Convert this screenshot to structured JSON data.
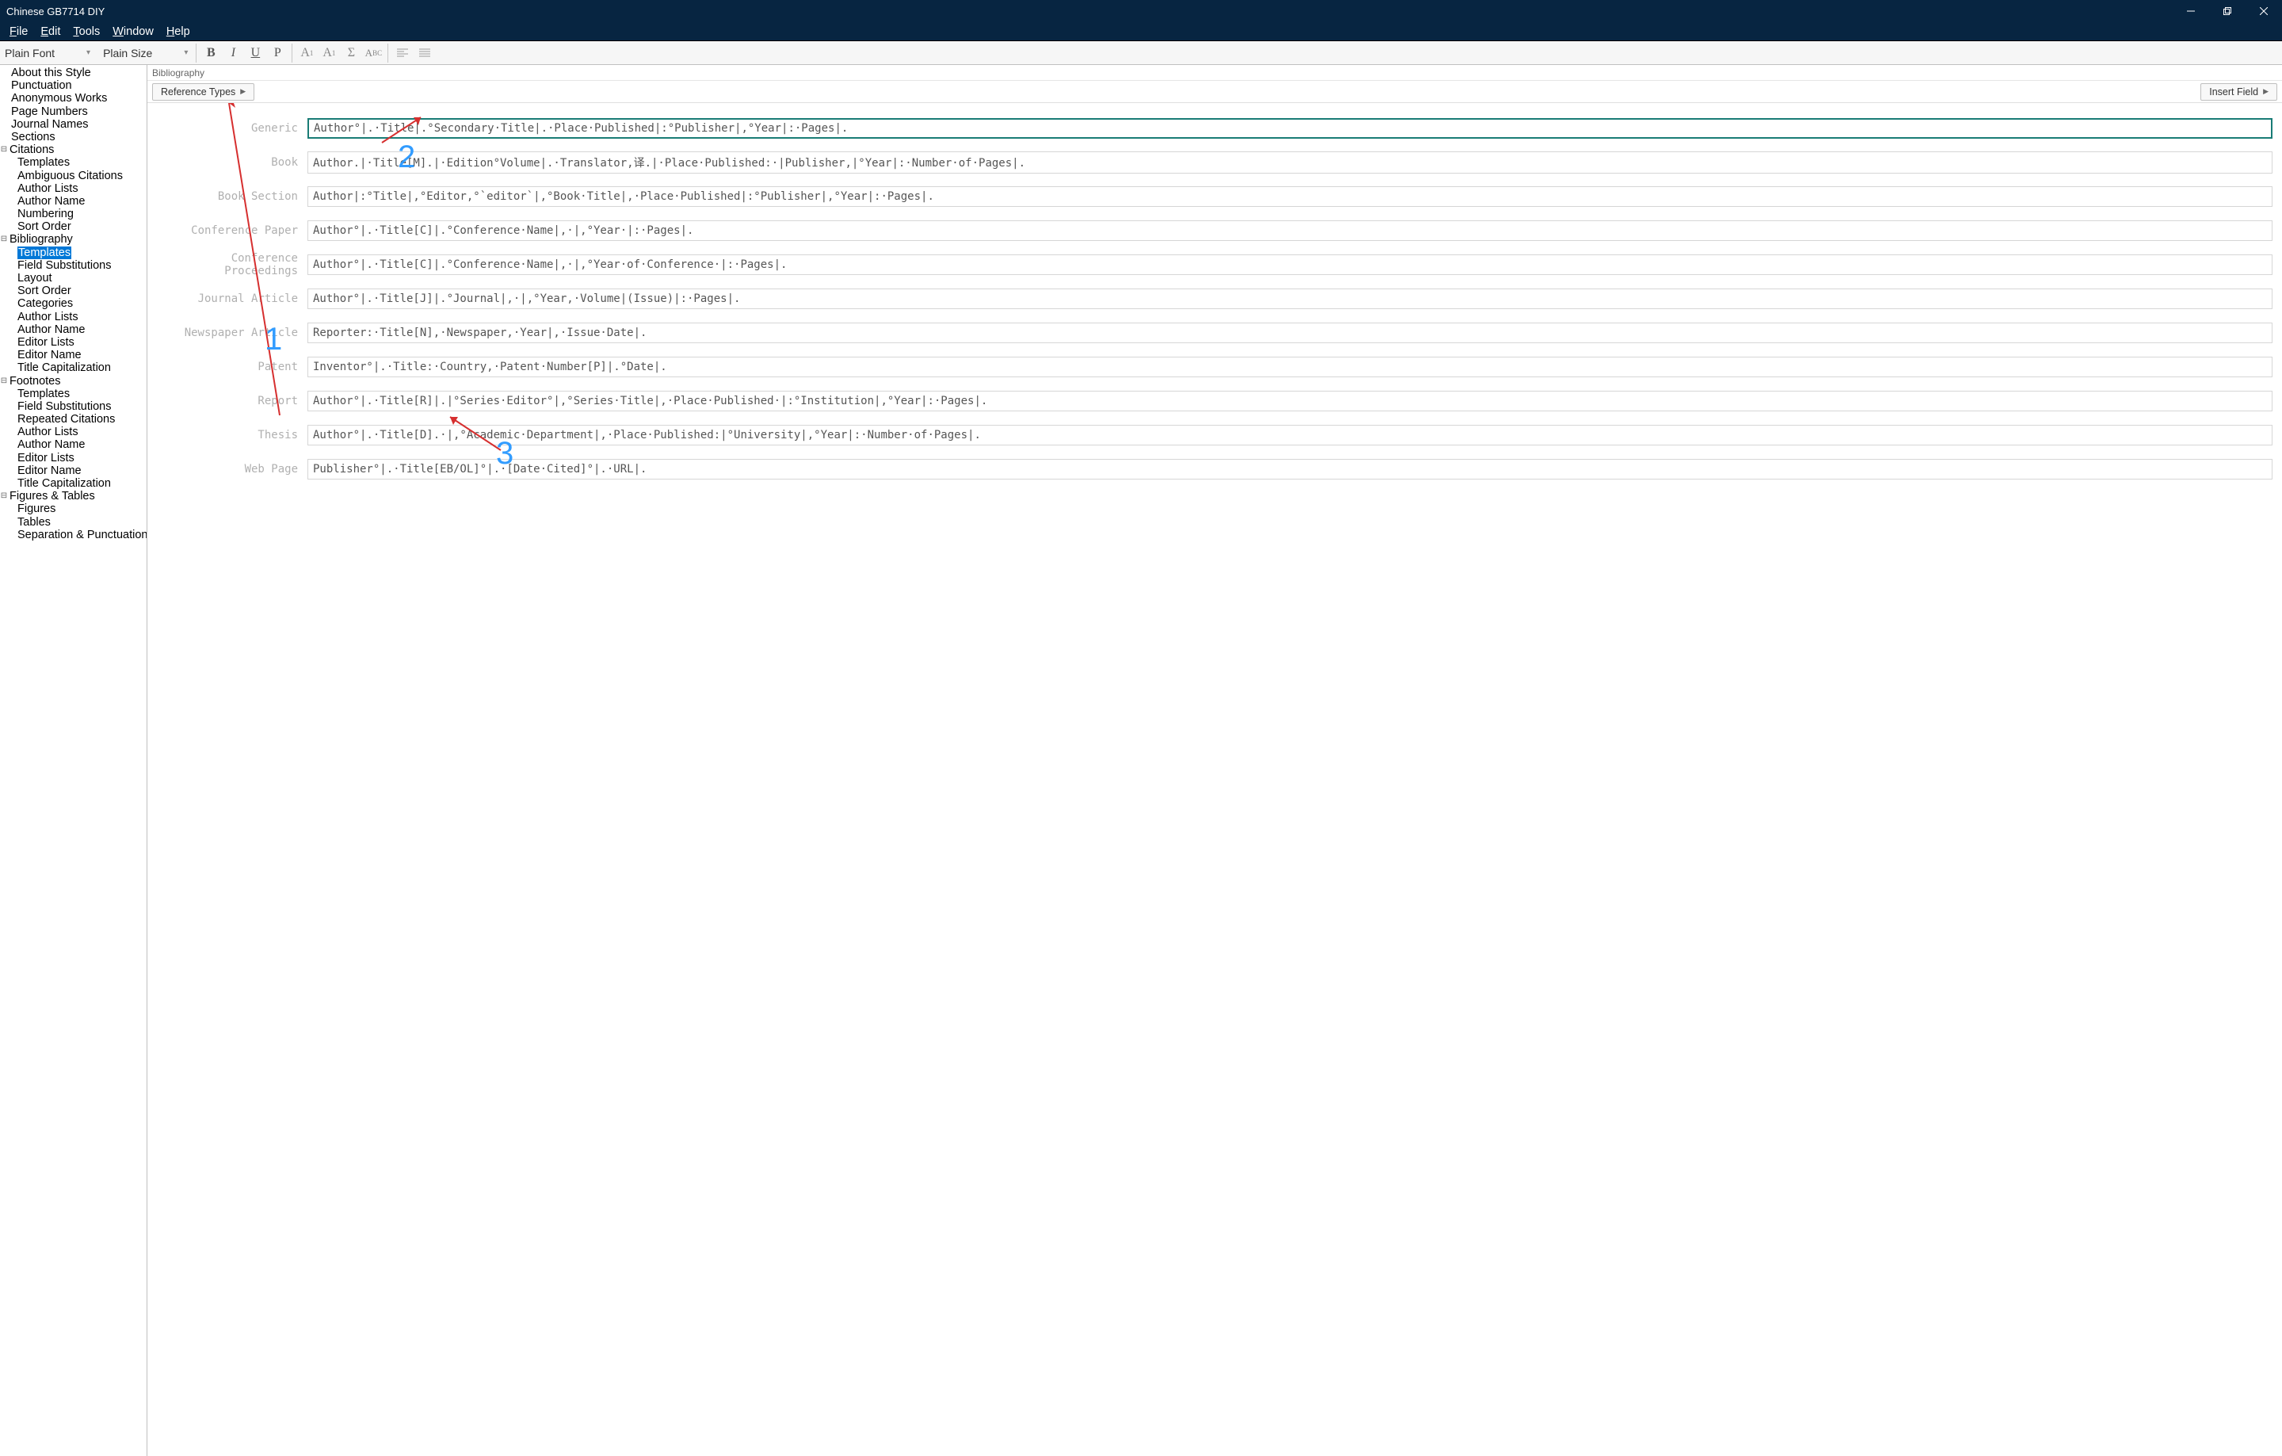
{
  "window": {
    "title": "Chinese GB7714 DIY"
  },
  "menu": {
    "file": "File",
    "edit": "Edit",
    "tools": "Tools",
    "window": "Window",
    "help": "Help"
  },
  "toolbar": {
    "font": "Plain Font",
    "size": "Plain Size"
  },
  "sidebar": {
    "about": "About this Style",
    "punctuation": "Punctuation",
    "anon": "Anonymous Works",
    "pagenums": "Page Numbers",
    "journalnames": "Journal Names",
    "sections": "Sections",
    "citations": {
      "label": "Citations",
      "templates": "Templates",
      "ambig": "Ambiguous Citations",
      "authorlists": "Author Lists",
      "authorname": "Author Name",
      "numbering": "Numbering",
      "sortorder": "Sort Order"
    },
    "bibliography": {
      "label": "Bibliography",
      "templates": "Templates",
      "fieldsubs": "Field Substitutions",
      "layout": "Layout",
      "sortorder": "Sort Order",
      "categories": "Categories",
      "authorlists": "Author Lists",
      "authorname": "Author Name",
      "editorlists": "Editor Lists",
      "editorname": "Editor Name",
      "titlecap": "Title Capitalization"
    },
    "footnotes": {
      "label": "Footnotes",
      "templates": "Templates",
      "fieldsubs": "Field Substitutions",
      "repeated": "Repeated Citations",
      "authorlists": "Author Lists",
      "authorname": "Author Name",
      "editorlists": "Editor Lists",
      "editorname": "Editor Name",
      "titlecap": "Title Capitalization"
    },
    "figtables": {
      "label": "Figures & Tables",
      "figures": "Figures",
      "tables": "Tables",
      "seppunc": "Separation & Punctuation"
    }
  },
  "main": {
    "crumb": "Bibliography",
    "btn_reftypes": "Reference Types",
    "btn_insertfield": "Insert Field",
    "rows": [
      {
        "label": "Generic",
        "value": "Author°|.·Title|.°Secondary·Title|.·Place·Published|:°Publisher|,°Year|:·Pages|.",
        "active": true
      },
      {
        "label": "Book",
        "value": "Author.|·Title[M].|·Edition°Volume|.·Translator,译.|·Place·Published:·|Publisher,|°Year|:·Number·of·Pages|."
      },
      {
        "label": "Book Section",
        "value": "Author|:°Title|,°Editor,°`editor`|,°Book·Title|,·Place·Published|:°Publisher|,°Year|:·Pages|."
      },
      {
        "label": "Conference Paper",
        "value": "Author°|.·Title[C]|.°Conference·Name|,·|,°Year·|:·Pages|."
      },
      {
        "label": "Conference Proceedings",
        "value": "Author°|.·Title[C]|.°Conference·Name|,·|,°Year·of·Conference·|:·Pages|."
      },
      {
        "label": "Journal Article",
        "value": "Author°|.·Title[J]|.°Journal|,·|,°Year,·Volume|(Issue)|:·Pages|."
      },
      {
        "label": "Newspaper Article",
        "value": "Reporter:·Title[N],·Newspaper,·Year|,·Issue·Date|."
      },
      {
        "label": "Patent",
        "value": "Inventor°|.·Title:·Country,·Patent·Number[P]|.°Date|."
      },
      {
        "label": "Report",
        "value": "Author°|.·Title[R]|.|°Series·Editor°|,°Series·Title|,·Place·Published·|:°Institution|,°Year|:·Pages|."
      },
      {
        "label": "Thesis",
        "value": "Author°|.·Title[D].·|,°Academic·Department|,·Place·Published:|°University|,°Year|:·Number·of·Pages|."
      },
      {
        "label": "Web Page",
        "value": "Publisher°|.·Title[EB/OL]°|.·[Date·Cited]°|.·URL|."
      }
    ]
  },
  "annotations": {
    "n1": "1",
    "n2": "2",
    "n3": "3"
  }
}
